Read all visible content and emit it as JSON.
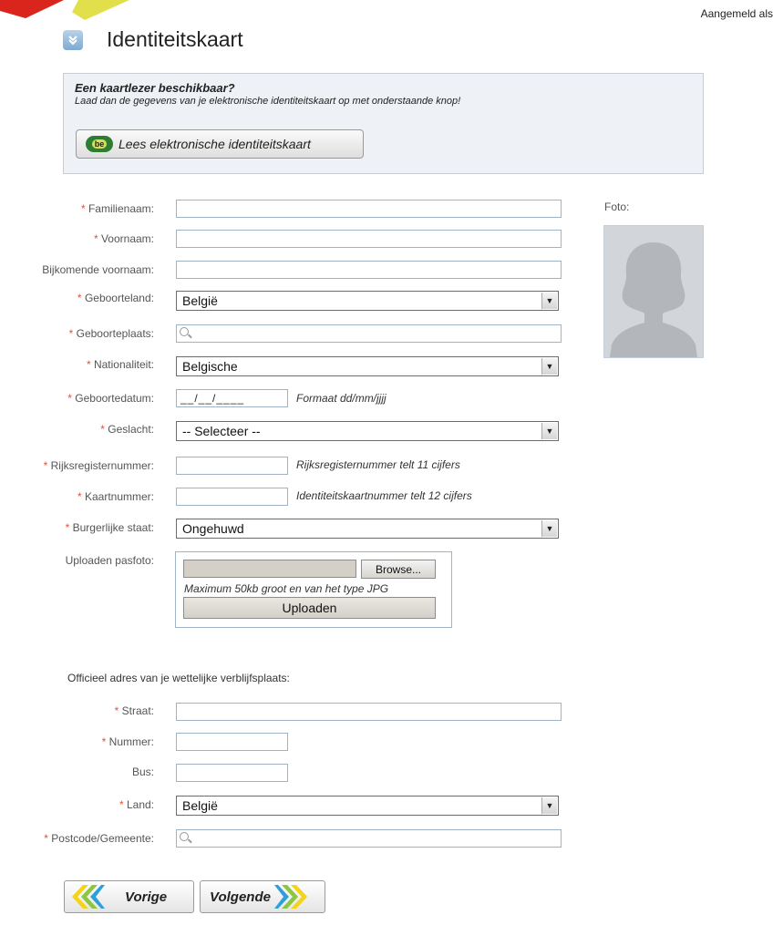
{
  "header": {
    "logged_in": "Aangemeld als",
    "title": "Identiteitskaart"
  },
  "card_reader": {
    "question": "Een kaartlezer beschikbaar?",
    "instruction": "Laad dan de gegevens van je elektronische identiteitskaart op met onderstaande knop!",
    "button_label": "Lees elektronische identiteitskaart",
    "logo_text": "be"
  },
  "form": {
    "familienaam": {
      "label": "Familienaam:",
      "required": true,
      "value": ""
    },
    "voornaam": {
      "label": "Voornaam:",
      "required": true,
      "value": ""
    },
    "bijkomende_voornaam": {
      "label": "Bijkomende voornaam:",
      "required": false,
      "value": ""
    },
    "geboorteland": {
      "label": "Geboorteland:",
      "required": true,
      "selected": "België"
    },
    "geboorteplaats": {
      "label": "Geboorteplaats:",
      "required": true,
      "value": ""
    },
    "nationaliteit": {
      "label": "Nationaliteit:",
      "required": true,
      "selected": "Belgische"
    },
    "geboortedatum": {
      "label": "Geboortedatum:",
      "required": true,
      "mask": "__/__/____",
      "hint": "Formaat dd/mm/jjjj"
    },
    "geslacht": {
      "label": "Geslacht:",
      "required": true,
      "selected": "-- Selecteer --"
    },
    "rijksregisternummer": {
      "label": "Rijksregisternummer:",
      "required": true,
      "value": "",
      "hint": "Rijksregisternummer telt 11 cijfers"
    },
    "kaartnummer": {
      "label": "Kaartnummer:",
      "required": true,
      "value": "",
      "hint": "Identiteitskaartnummer telt 12 cijfers"
    },
    "burgerlijke_staat": {
      "label": "Burgerlijke staat:",
      "required": true,
      "selected": "Ongehuwd"
    },
    "pasfoto": {
      "label": "Uploaden pasfoto:",
      "browse_label": "Browse...",
      "hint": "Maximum 50kb groot en van het type JPG",
      "upload_label": "Uploaden"
    }
  },
  "foto": {
    "label": "Foto:"
  },
  "address": {
    "heading": "Officieel adres van je wettelijke verblijfsplaats:",
    "straat": {
      "label": "Straat:",
      "required": true,
      "value": ""
    },
    "nummer": {
      "label": "Nummer:",
      "required": true,
      "value": ""
    },
    "bus": {
      "label": "Bus:",
      "required": false,
      "value": ""
    },
    "land": {
      "label": "Land:",
      "required": true,
      "selected": "België"
    },
    "postcode": {
      "label": "Postcode/Gemeente:",
      "required": true,
      "value": ""
    }
  },
  "required_marker": "*",
  "nav": {
    "prev_label": "Vorige",
    "next_label": "Volgende"
  },
  "colors": {
    "required": "#e0533a",
    "chevron_green": "#8dc63f",
    "chevron_yellow": "#f5d417",
    "chevron_blue": "#2e9fd8"
  }
}
